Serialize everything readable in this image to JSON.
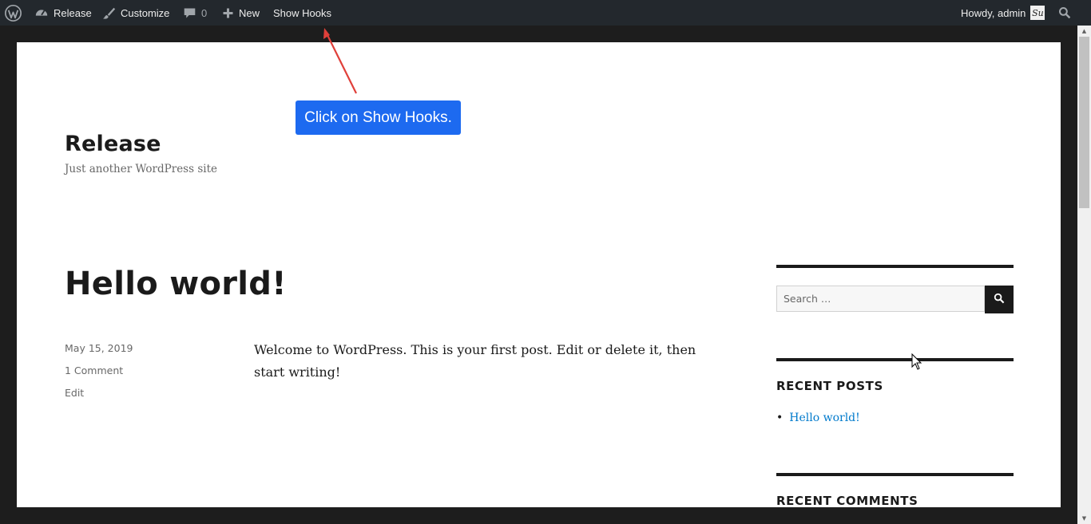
{
  "adminbar": {
    "site_name": "Release",
    "customize": "Customize",
    "comments_count": "0",
    "new": "New",
    "show_hooks": "Show Hooks",
    "howdy": "Howdy, admin",
    "avatar_text": "Su"
  },
  "tooltip": {
    "text": "Click on Show Hooks."
  },
  "site": {
    "title": "Release",
    "description": "Just another WordPress site"
  },
  "post": {
    "title": "Hello world!",
    "date": "May 15, 2019",
    "comments": "1 Comment",
    "edit": "Edit",
    "content": "Welcome to WordPress. This is your first post. Edit or delete it, then start writing!"
  },
  "sidebar": {
    "search_placeholder": "Search …",
    "recent_posts_title": "Recent Posts",
    "recent_posts": [
      "Hello world!"
    ],
    "recent_comments_title": "Recent Comments"
  },
  "colors": {
    "adminbar_bg": "#23282d",
    "tooltip_bg": "#1d6af0",
    "link": "#007acc",
    "arrow": "#e0403a"
  }
}
